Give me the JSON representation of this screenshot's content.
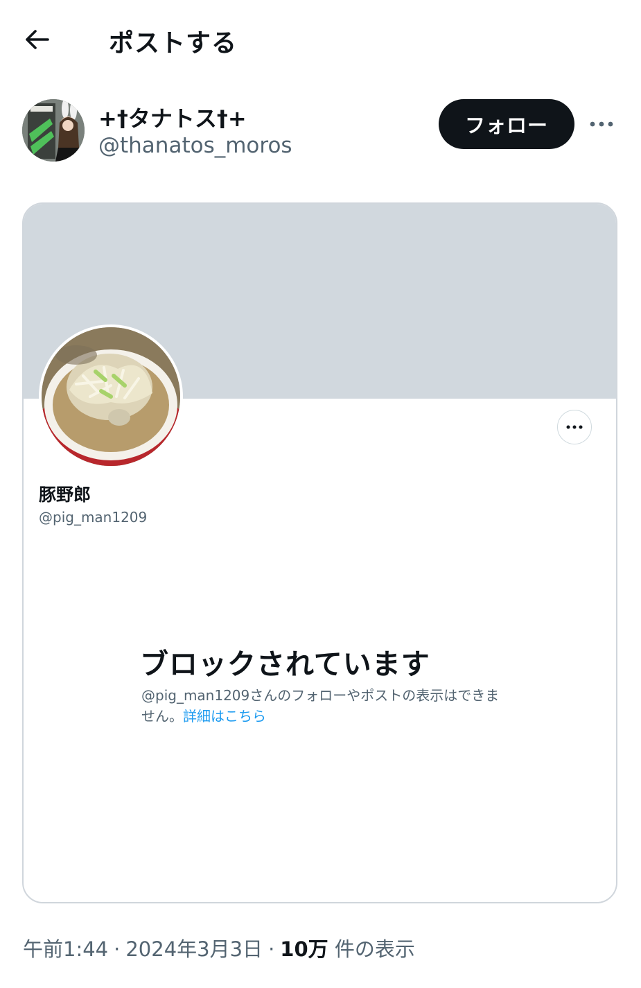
{
  "header": {
    "title": "ポストする",
    "back_icon": "arrow-left-icon"
  },
  "author": {
    "display_name": "+†タナトス†+",
    "handle": "@thanatos_moros",
    "follow_label": "フォロー",
    "more_icon": "ellipsis-icon"
  },
  "card": {
    "blocked_display_name": "豚野郎",
    "blocked_handle": "@pig_man1209",
    "blocked_title": "ブロックされています",
    "blocked_description": "@pig_man1209さんのフォローやポストの表示はできません。",
    "learn_more_link": "詳細はこちら",
    "colors": {
      "banner": "#d1d8de",
      "link": "#1d9bf0"
    }
  },
  "meta": {
    "time": "午前1:44",
    "date": "2024年3月3日",
    "views_count": "10万",
    "views_label": "件の表示"
  },
  "colors": {
    "text_primary": "#0f1419",
    "text_secondary": "#536471",
    "follow_button_bg": "#0f1419"
  }
}
